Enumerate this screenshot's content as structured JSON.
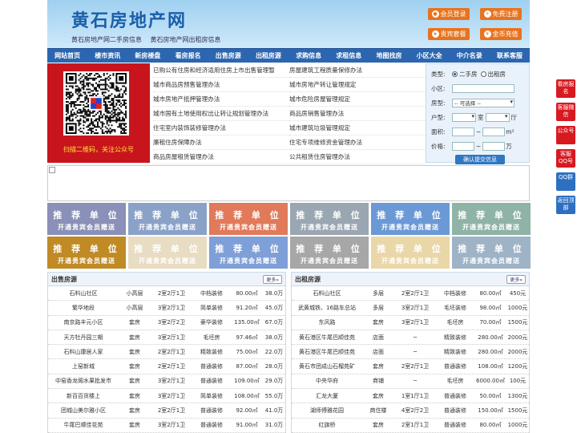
{
  "header": {
    "logo": "黄石房地产网",
    "subtitle1": "黄石房地产网二手房信息",
    "subtitle2": "黄石房地产网出租房信息",
    "buttons": [
      "会员登录",
      "免费注册",
      "贵宾套餐",
      "金币充值"
    ]
  },
  "nav": [
    "网站首页",
    "楼市资讯",
    "新房楼盘",
    "看房报名",
    "出售房源",
    "出租房源",
    "求购信息",
    "求租信息",
    "地图找房",
    "小区大全",
    "中介名录",
    "联系客服"
  ],
  "qr": {
    "caption": "扫描二维码，关注公众号"
  },
  "links": {
    "left": [
      "已购公有住房和经济适用住房上市出售管理暂",
      "城市商品房预售管理办法",
      "城市房地产抵押管理办法",
      "城市国有土地使用权出让转让规划管理办法",
      "住宅室内装饰装修管理办法",
      "廉租住房保障办法",
      "商品房屋租赁管理办法"
    ],
    "right": [
      "房屋建筑工程质量保修办法",
      "城市房地产转让管理规定",
      "城市危险房屋管理规定",
      "商品房销售管理办法",
      "城市建筑垃圾管理规定",
      "住宅专项维修资金管理办法",
      "公共租赁住房管理办法"
    ]
  },
  "search": {
    "type_label": "类型:",
    "opt1": "二手房",
    "opt2": "出租房",
    "district_label": "小区:",
    "housing_label": "房型:",
    "housing_value": "-- 可选择 --",
    "layout_label": "户型:",
    "room_unit": "室",
    "hall_unit": "厅",
    "area_label": "面积:",
    "area_unit": "m²",
    "price_label": "价格:",
    "price_unit": "万",
    "range_sep": "~",
    "submit": "确认提交信息"
  },
  "ads": {
    "title": "推 荐 单 位",
    "sub": "开通贵宾会员赠送",
    "colors": [
      "#8a90b8",
      "#8aa2c8",
      "#e07a5a",
      "#9aa6b2",
      "#6b99d6",
      "#8fb3a6",
      "#c08a24",
      "#e8dcc2",
      "#7f9fd8",
      "#a7a7a7",
      "#ead7a8",
      "#9fb3c7"
    ]
  },
  "sale": {
    "title": "出售房源",
    "more": "更多»",
    "rows": [
      [
        "石料山社区",
        "小高层",
        "2室2厅1卫",
        "中档装修",
        "80.00㎡",
        "38.0万"
      ],
      [
        "繁华地段",
        "小高层",
        "3室2厅1卫",
        "简单装修",
        "91.20㎡",
        "45.0万"
      ],
      [
        "南京路丰元小区",
        "套房",
        "3室2厅2卫",
        "豪华装修",
        "135.00㎡",
        "67.0万"
      ],
      [
        "天方牡丹园三期",
        "套房",
        "3室2厅1卫",
        "毛坯房",
        "97.46㎡",
        "38.0万"
      ],
      [
        "石料山康居人家",
        "套房",
        "2室2厅1卫",
        "精致装修",
        "75.00㎡",
        "22.0万"
      ],
      [
        "上窑新城",
        "套房",
        "2室2厅1卫",
        "普通装修",
        "87.00㎡",
        "28.0万"
      ],
      [
        "中窑香龙阁水果批发市",
        "套房",
        "3室2厅1卫",
        "普通装修",
        "109.00㎡",
        "29.0万"
      ],
      [
        "新百百货楼上",
        "套房",
        "3室2厅1卫",
        "简单装修",
        "108.00㎡",
        "55.0万"
      ],
      [
        "团城山美尔雅小区",
        "套房",
        "2室2厅1卫",
        "普通装修",
        "92.00㎡",
        "41.0万"
      ],
      [
        "牛尾巴顺佳花苑",
        "套房",
        "3室2厅1卫",
        "普通装修",
        "91.00㎡",
        "31.0万"
      ]
    ]
  },
  "rent": {
    "title": "出租房源",
    "more": "更多»",
    "rows": [
      [
        "石料山社区",
        "多层",
        "2室2厅1卫",
        "中档装修",
        "80.00㎡",
        "450元"
      ],
      [
        "武黄城铁、16路车总站",
        "多层",
        "3室2厅1卫",
        "毛坯装修",
        "98.00㎡",
        "1000元"
      ],
      [
        "东风路",
        "套房",
        "3室2厅1卫",
        "毛坯房",
        "70.00㎡",
        "1500元"
      ],
      [
        "黄石港区牛尾巴顺佳苑",
        "店面",
        "─",
        "精致装修",
        "280.00㎡",
        "2000元"
      ],
      [
        "黄石港区牛尾巴顺佳苑",
        "店面",
        "─",
        "精致装修",
        "280.00㎡",
        "2000元"
      ],
      [
        "黄石市团成山石榴苑矿",
        "套房",
        "2室2厅1卫",
        "普通装修",
        "108.00㎡",
        "1200元"
      ],
      [
        "中央华府",
        "商铺",
        "─",
        "毛坯房",
        "6000.00㎡",
        "100元"
      ],
      [
        "汇龙大厦",
        "套房",
        "1室1厅1卫",
        "普通装修",
        "50.00㎡",
        "1300元"
      ],
      [
        "湖师傅雅花园",
        "商住楼",
        "4室2厅2卫",
        "普通装修",
        "150.00㎡",
        "1500元"
      ],
      [
        "红旗桥",
        "套房",
        "2室1厅1卫",
        "普通装修",
        "80.00㎡",
        "1000元"
      ]
    ]
  },
  "floats": [
    "看房报名",
    "客服微信",
    "公众号",
    "客服QQ号",
    "QQ群",
    "返回顶部"
  ]
}
